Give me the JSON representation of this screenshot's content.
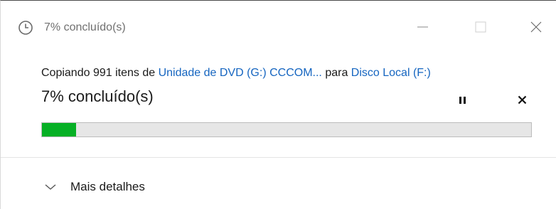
{
  "window": {
    "title": "7% concluído(s)",
    "icon": "clock-icon"
  },
  "copy": {
    "prefix": "Copiando 991 itens de",
    "source": "Unidade de DVD (G:) CCCOM...",
    "middle": "para",
    "destination": "Disco Local (F:)"
  },
  "progress": {
    "label": "7% concluído(s)",
    "fraction": 0.07,
    "fill_color": "#06b025"
  },
  "controls": {
    "pause_icon": "pause-icon",
    "stop_icon": "close-icon"
  },
  "details": {
    "label": "Mais detalhes",
    "icon": "chevron-down-icon"
  }
}
